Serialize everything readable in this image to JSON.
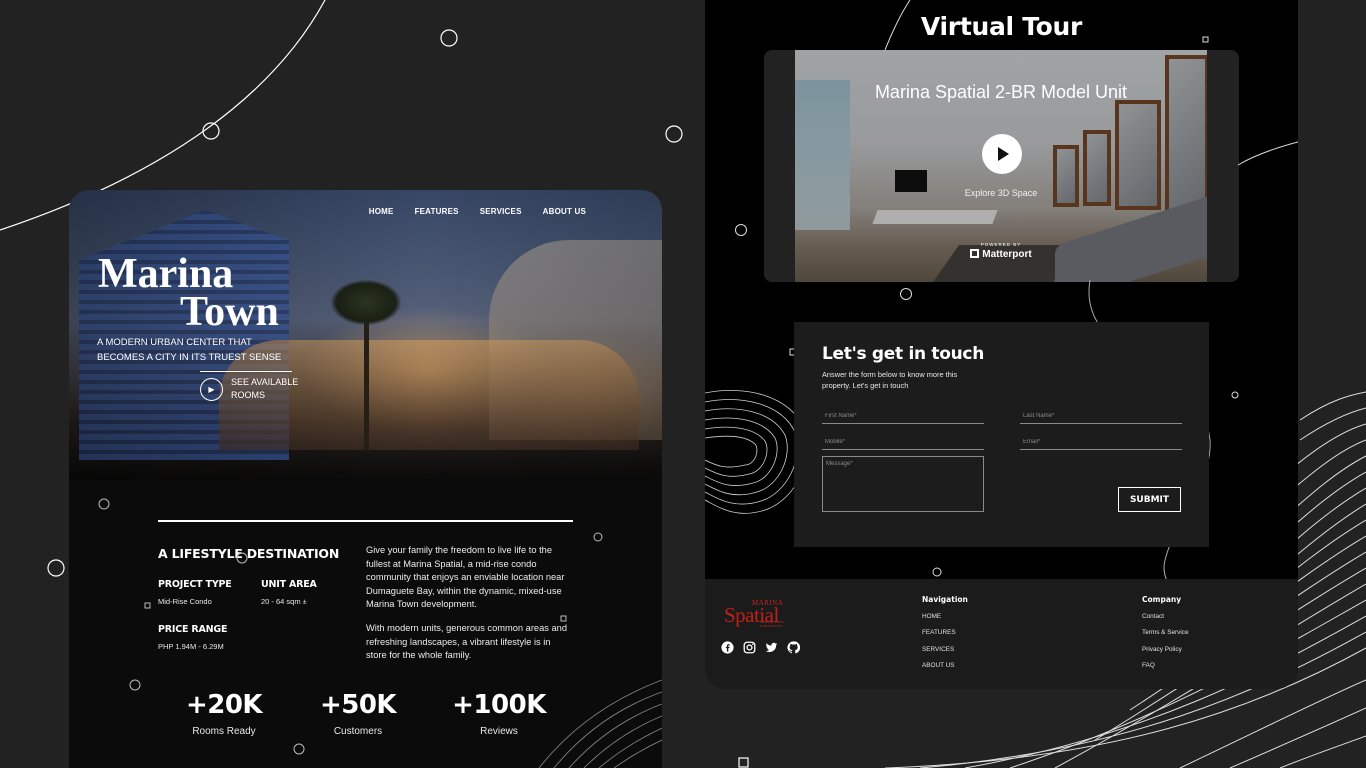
{
  "left": {
    "nav": [
      "HOME",
      "FEATURES",
      "SERVICES",
      "ABOUT US"
    ],
    "hero": {
      "title_line1": "Marina",
      "title_line2": "Town",
      "tagline": "A MODERN URBAN CENTER THAT BECOMES A CITY IN ITS TRUEST SENSE",
      "cta": "SEE AVAILABLE ROOMS",
      "cta_icon": "play-icon"
    },
    "section_title": "A LIFESTYLE DESTINATION",
    "project_type": {
      "label": "PROJECT TYPE",
      "value": "Mid-Rise Condo"
    },
    "unit_area": {
      "label": "UNIT AREA",
      "value": "20 - 64 sqm ±"
    },
    "price_range": {
      "label": "PRICE RANGE",
      "value": "PHP 1.94M - 6.29M"
    },
    "desc1": "Give your family the freedom to live life to the fullest at Marina Spatial, a mid-rise condo community that enjoys an enviable location near Dumaguete Bay, within the dynamic, mixed-use Marina Town development.",
    "desc2": "With modern units, generous common areas and refreshing landscapes, a vibrant lifestyle is in store for the whole family.",
    "stats": [
      {
        "number": "+20K",
        "label": "Rooms Ready"
      },
      {
        "number": "+50K",
        "label": "Customers"
      },
      {
        "number": "+100K",
        "label": "Reviews"
      }
    ]
  },
  "right": {
    "virtual_tour_title": "Virtual Tour",
    "tour": {
      "name": "Marina Spatial 2-BR Model Unit",
      "explore": "Explore 3D Space",
      "powered_by": "POWERED BY",
      "brand": "Matterport"
    },
    "contact": {
      "title": "Let's get in touch",
      "subtitle": "Answer the form below to know more this property. Let's get in touch",
      "first_name_placeholder": "First Name*",
      "last_name_placeholder": "Last Name*",
      "mobile_placeholder": "Mobile*",
      "email_placeholder": "Email*",
      "message_placeholder": "Message*",
      "submit": "SUBMIT"
    },
    "footer": {
      "logo_top": "MARINA",
      "logo_main": "Spatial",
      "logo_sub": "MARINA TOWN · DUMAGUETE",
      "social_icons": [
        "facebook-icon",
        "instagram-icon",
        "twitter-icon",
        "github-icon"
      ],
      "navigation": {
        "heading": "Navigation",
        "links": [
          "HOME",
          "FEATURES",
          "SERVICES",
          "ABOUT US"
        ]
      },
      "company": {
        "heading": "Company",
        "links": [
          "Contact",
          "Terms & Service",
          "Privacy Policy",
          "FAQ"
        ]
      }
    }
  },
  "colors": {
    "background": "#222222",
    "card": "#000000",
    "logo_red": "#c0201a",
    "panel": "#1c1c1c"
  }
}
